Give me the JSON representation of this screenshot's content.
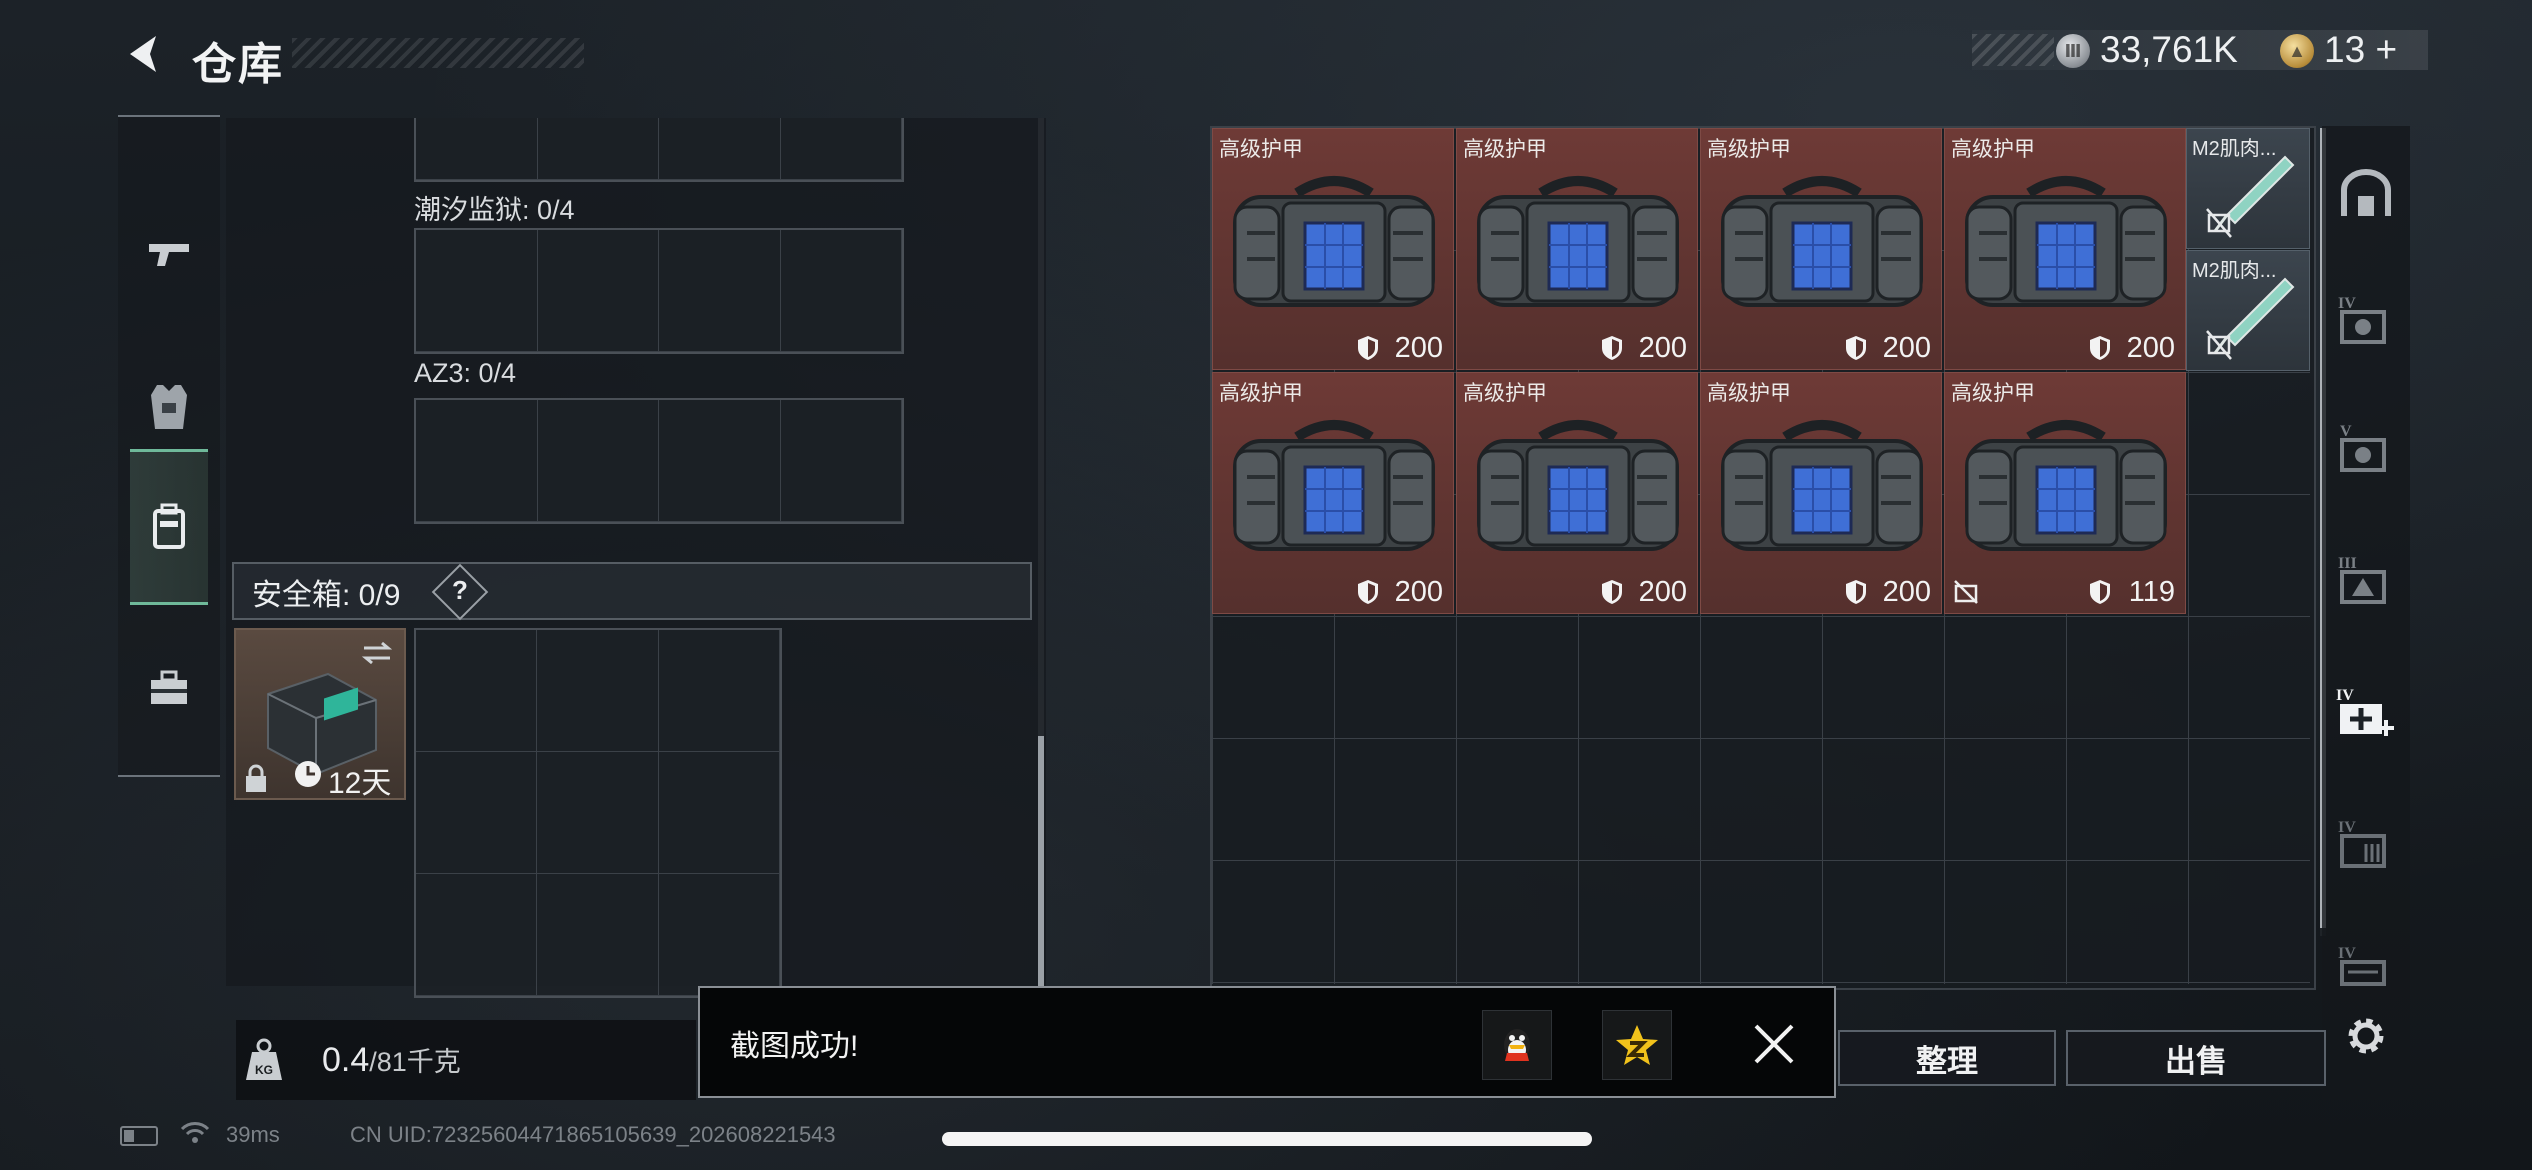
{
  "header": {
    "title": "仓库",
    "currency": {
      "silver_amount": "33,761K",
      "gold_amount": "13",
      "gold_add_symbol": "+"
    }
  },
  "left_nav": {
    "items": [
      {
        "name": "weapons",
        "icon": "pistol-icon"
      },
      {
        "name": "armor",
        "icon": "vest-icon"
      },
      {
        "name": "backpack",
        "icon": "backpack-icon",
        "active": true
      },
      {
        "name": "supplies",
        "icon": "toolbox-icon"
      }
    ]
  },
  "containers": {
    "tide_prison_label": "潮汐监狱: 0/4",
    "az3_label": "AZ3: 0/4",
    "safebox_label": "安全箱: 0/9",
    "safebox_help": "?",
    "safebox_item_days": "12天"
  },
  "weight": {
    "current": "0.4",
    "max": "/81千克"
  },
  "inventory": {
    "armor_items": [
      {
        "name": "高级护甲",
        "value": "200",
        "locked": false
      },
      {
        "name": "高级护甲",
        "value": "200",
        "locked": false
      },
      {
        "name": "高级护甲",
        "value": "200",
        "locked": false
      },
      {
        "name": "高级护甲",
        "value": "200",
        "locked": false
      },
      {
        "name": "高级护甲",
        "value": "200",
        "locked": false
      },
      {
        "name": "高级护甲",
        "value": "200",
        "locked": false
      },
      {
        "name": "高级护甲",
        "value": "200",
        "locked": false
      },
      {
        "name": "高级护甲",
        "value": "119",
        "locked": true
      }
    ],
    "syringe_items": [
      {
        "name": "M2肌肉..."
      },
      {
        "name": "M2肌肉..."
      }
    ]
  },
  "actions": {
    "sort_label": "整理",
    "sell_label": "出售"
  },
  "toast": {
    "message": "截图成功!"
  },
  "status": {
    "ping": "39ms",
    "uid": "CN UID:7232560447186510563​9_202608221543"
  }
}
